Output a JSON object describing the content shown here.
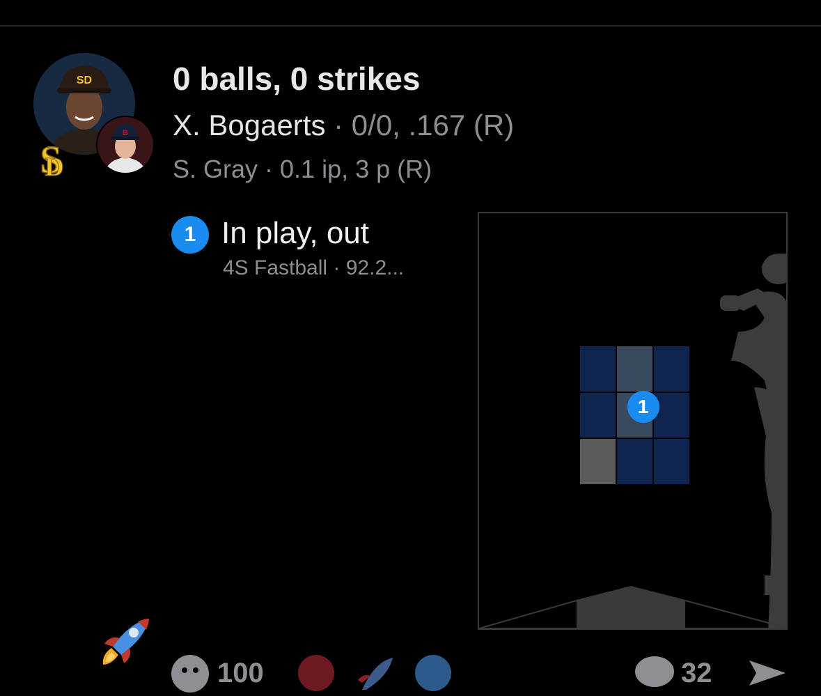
{
  "count": {
    "title": "0 balls, 0 strikes"
  },
  "batter": {
    "name": "X. Bogaerts",
    "stats": " · 0/0, .167 (R)"
  },
  "pitcher": {
    "line": "S. Gray · 0.1 ip, 3 p (R)"
  },
  "pitch": {
    "number": "1",
    "result": "In play, out",
    "detail": "4S Fastball ·  92.2..."
  },
  "zone": {
    "marker": "1",
    "cells": [
      "#0f2550",
      "#3a4a5e",
      "#0f2550",
      "#0f2550",
      "#3a4a5e",
      "#0f2550",
      "#5a5a5a",
      "#0f2550",
      "#0f2550"
    ]
  },
  "reactions": {
    "count_left": "100",
    "count_right": "32"
  },
  "icons": {
    "team_logo": "padres-sd-logo-icon",
    "rocket": "rocket-icon",
    "reaction": "emoji-face-icon",
    "comment": "comment-bubble-icon",
    "share": "share-arrow-icon"
  },
  "colors": {
    "accent": "#1a8cf0",
    "logo_gold": "#f2c32b"
  }
}
